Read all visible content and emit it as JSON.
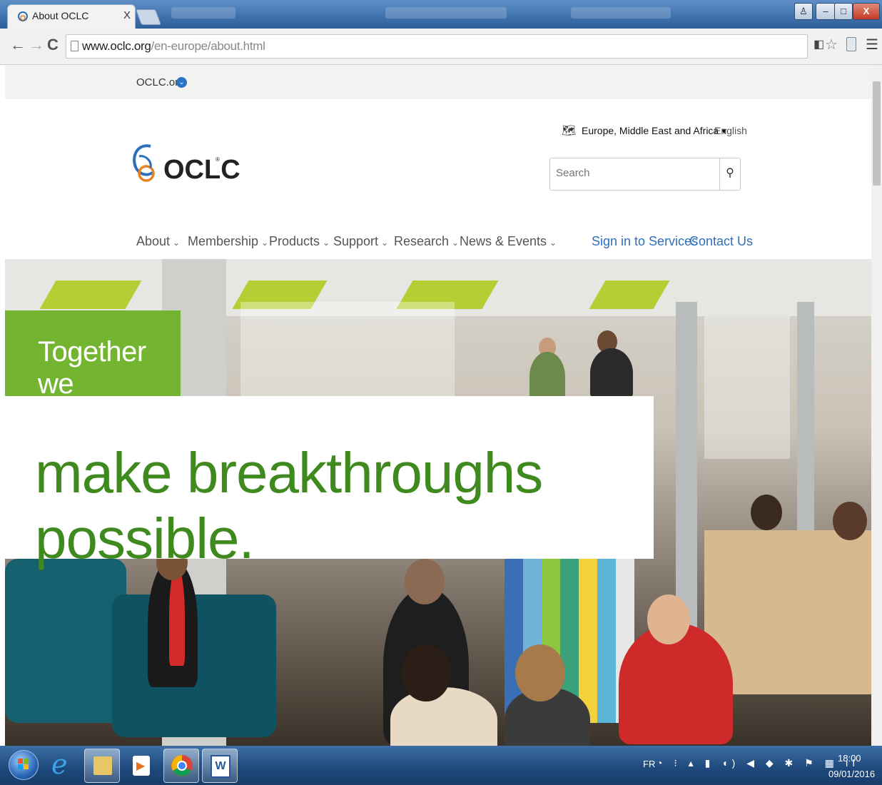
{
  "browser": {
    "tab_title": "About OCLC",
    "tab_close": "X",
    "url_host": "www.oclc.org",
    "url_path": "/en-europe/about.html",
    "window_buttons": {
      "minimize": "–",
      "maximize": "□",
      "close": "X"
    },
    "nav": {
      "back": "←",
      "forward": "→",
      "reload": "C"
    },
    "menu_icon": "☰",
    "star_icon": "☆"
  },
  "site_bar": {
    "link": "OCLC.org"
  },
  "header": {
    "logo_text": "OCLC",
    "logo_reg": "®",
    "region": "Europe, Middle East and Africa ▾",
    "language": "English",
    "search_placeholder": "Search"
  },
  "nav": {
    "items": [
      {
        "label": "About"
      },
      {
        "label": "Membership"
      },
      {
        "label": "Products"
      },
      {
        "label": "Support"
      },
      {
        "label": "Research"
      },
      {
        "label": "News & Events"
      }
    ],
    "chevron": "⌄",
    "sign_in": "Sign in to Services",
    "contact": "Contact Us"
  },
  "hero": {
    "line1": "Together we",
    "line2": "make breakthroughs possible."
  },
  "taskbar": {
    "lang": "FR",
    "time": "18:00",
    "date": "09/01/2016"
  },
  "colors": {
    "brand_green": "#73b531",
    "text_green": "#3f8a1e",
    "link_blue": "#2d6fb8"
  }
}
